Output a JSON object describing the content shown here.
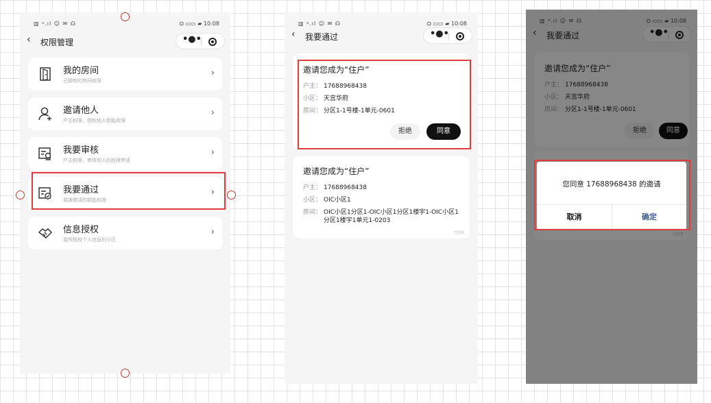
{
  "status": {
    "left": "▥ ᵃ.ıl ☺ ✉ ☊",
    "right": "⛭ ▭▭ ▰ 10:08"
  },
  "screen1": {
    "title": "权限管理",
    "capsule_dots": "•●•",
    "items": [
      {
        "title": "我的房间",
        "subtitle": "已拥有的房间权限",
        "icon": "door-icon"
      },
      {
        "title": "邀请他人",
        "subtitle": "户主权限，授权他人钥匙权限",
        "icon": "person-add-icon"
      },
      {
        "title": "我要审核",
        "subtitle": "户主权限，审核别人的权限申请",
        "icon": "review-icon"
      },
      {
        "title": "我要通过",
        "subtitle": "我被邀请的钥匙权限",
        "icon": "approve-icon"
      },
      {
        "title": "信息授权",
        "subtitle": "我所授权个人信息的小区",
        "icon": "handshake-icon"
      }
    ],
    "arrow": "›"
  },
  "screen2": {
    "title": "我要通过",
    "capsule_dots": "•●•",
    "cards": [
      {
        "title": "邀请您成为“住户”",
        "owner_label": "户主：",
        "owner": "17688968438",
        "community_label": "小区：",
        "community": "天宫华府",
        "room_label": "房间：",
        "room": "分区1-1号楼-1单元-0601",
        "reject": "拒绝",
        "agree": "同意"
      },
      {
        "title": "邀请您成为“住户”",
        "owner_label": "户主：",
        "owner": "17688968438",
        "community_label": "小区：",
        "community": "OIC小区1",
        "room_label": "房间：",
        "room": "OIC小区1分区1-OIC小区1分区1楼宇1-OIC小区1分区1楼宇1单元1-0203",
        "status": "已同意"
      }
    ]
  },
  "screen3": {
    "title": "我要通过",
    "capsule_dots": "•●•",
    "card": {
      "title": "邀请您成为“住户”",
      "owner_label": "户主：",
      "owner": "17688968438",
      "community_label": "小区：",
      "community": "天宫华府",
      "room_label": "房间：",
      "room": "分区1-1号楼-1单元-0601",
      "reject": "拒绝",
      "agree": "同意"
    },
    "dialog": {
      "message": "您同意 17688968438 的邀请",
      "cancel": "取消",
      "confirm": "确定"
    },
    "behind_status": "已同意"
  },
  "colors": {
    "highlight": "#e23b3b",
    "confirm": "#3c5a96",
    "agree_button": "#111111"
  }
}
